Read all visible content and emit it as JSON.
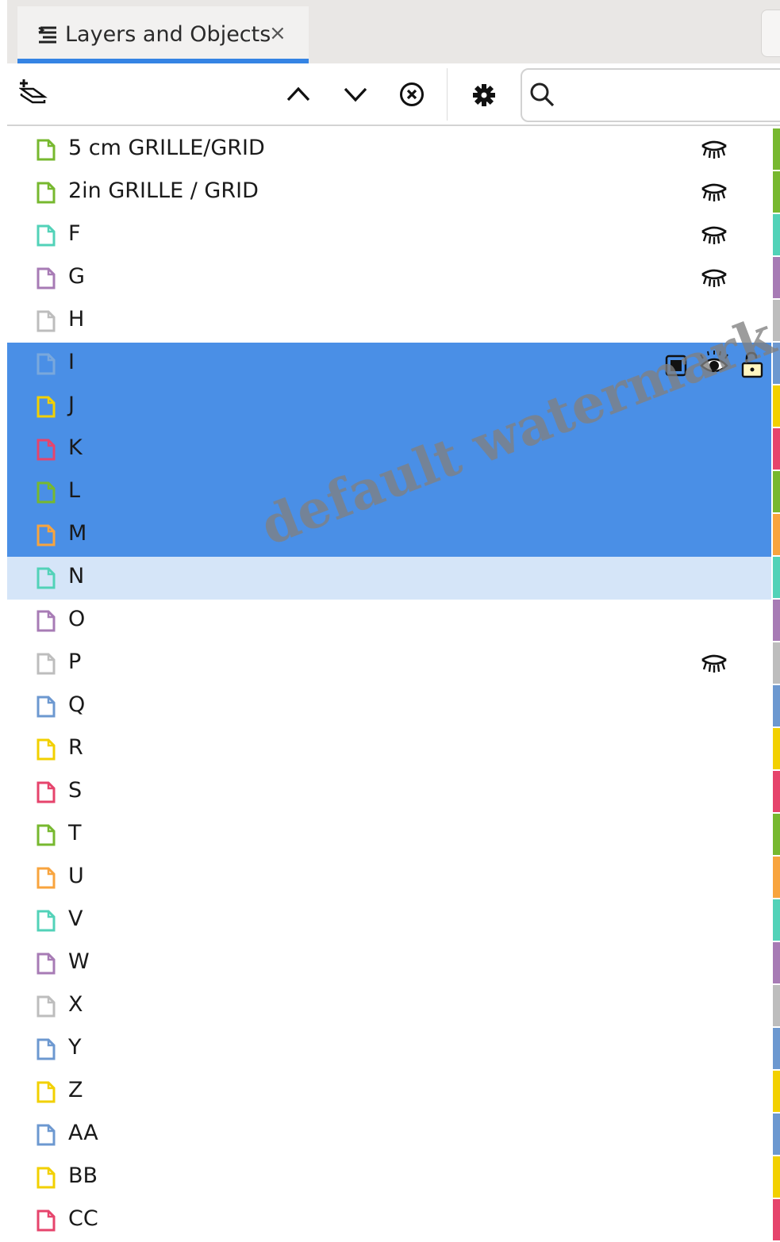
{
  "panel": {
    "tab_title": "Layers and Objects",
    "tab_close": "×",
    "tab_icon": "layers-icon"
  },
  "toolbar": {
    "add_layer_icon": "add-layer-icon",
    "move_up_icon": "chevron-up-icon",
    "move_down_icon": "chevron-down-icon",
    "delete_icon": "delete-circle-x-icon",
    "settings_icon": "gear-icon",
    "search_icon": "search-icon",
    "search_value": ""
  },
  "layers": [
    {
      "name": "5 cm GRILLE/GRID",
      "color": "#77b82f",
      "hidden": true,
      "state": "normal"
    },
    {
      "name": "2in GRILLE / GRID",
      "color": "#77b82f",
      "hidden": true,
      "state": "normal"
    },
    {
      "name": "F",
      "color": "#52d2b8",
      "hidden": true,
      "state": "normal"
    },
    {
      "name": "G",
      "color": "#a77bb5",
      "hidden": true,
      "state": "normal"
    },
    {
      "name": "H",
      "color": "#bdbdbd",
      "hidden": false,
      "state": "normal"
    },
    {
      "name": "I",
      "color": "#6c98d0",
      "hidden": false,
      "state": "selected-primary"
    },
    {
      "name": "J",
      "color": "#f2d000",
      "hidden": false,
      "state": "selected"
    },
    {
      "name": "K",
      "color": "#e6446c",
      "hidden": false,
      "state": "selected"
    },
    {
      "name": "L",
      "color": "#77b82f",
      "hidden": false,
      "state": "selected"
    },
    {
      "name": "M",
      "color": "#f8a43e",
      "hidden": false,
      "state": "selected"
    },
    {
      "name": "N",
      "color": "#52d2b8",
      "hidden": false,
      "state": "hover"
    },
    {
      "name": "O",
      "color": "#a77bb5",
      "hidden": false,
      "state": "normal"
    },
    {
      "name": "P",
      "color": "#bdbdbd",
      "hidden": true,
      "state": "normal"
    },
    {
      "name": "Q",
      "color": "#6c98d0",
      "hidden": false,
      "state": "normal"
    },
    {
      "name": "R",
      "color": "#f2d000",
      "hidden": false,
      "state": "normal"
    },
    {
      "name": "S",
      "color": "#e6446c",
      "hidden": false,
      "state": "normal"
    },
    {
      "name": "T",
      "color": "#77b82f",
      "hidden": false,
      "state": "normal"
    },
    {
      "name": "U",
      "color": "#f8a43e",
      "hidden": false,
      "state": "normal"
    },
    {
      "name": "V",
      "color": "#52d2b8",
      "hidden": false,
      "state": "normal"
    },
    {
      "name": "W",
      "color": "#a77bb5",
      "hidden": false,
      "state": "normal"
    },
    {
      "name": "X",
      "color": "#bdbdbd",
      "hidden": false,
      "state": "normal"
    },
    {
      "name": "Y",
      "color": "#6c98d0",
      "hidden": false,
      "state": "normal"
    },
    {
      "name": "Z",
      "color": "#f2d000",
      "hidden": false,
      "state": "normal"
    },
    {
      "name": "AA",
      "color": "#6c98d0",
      "hidden": false,
      "state": "normal"
    },
    {
      "name": "BB",
      "color": "#f2d000",
      "hidden": false,
      "state": "normal"
    },
    {
      "name": "CC",
      "color": "#e6446c",
      "hidden": false,
      "state": "normal"
    }
  ],
  "colors": {
    "selected_bg": "#4a8fe6",
    "hover_bg": "#d5e5f8",
    "tab_underline": "#3584e4"
  },
  "watermark": "default watermark"
}
